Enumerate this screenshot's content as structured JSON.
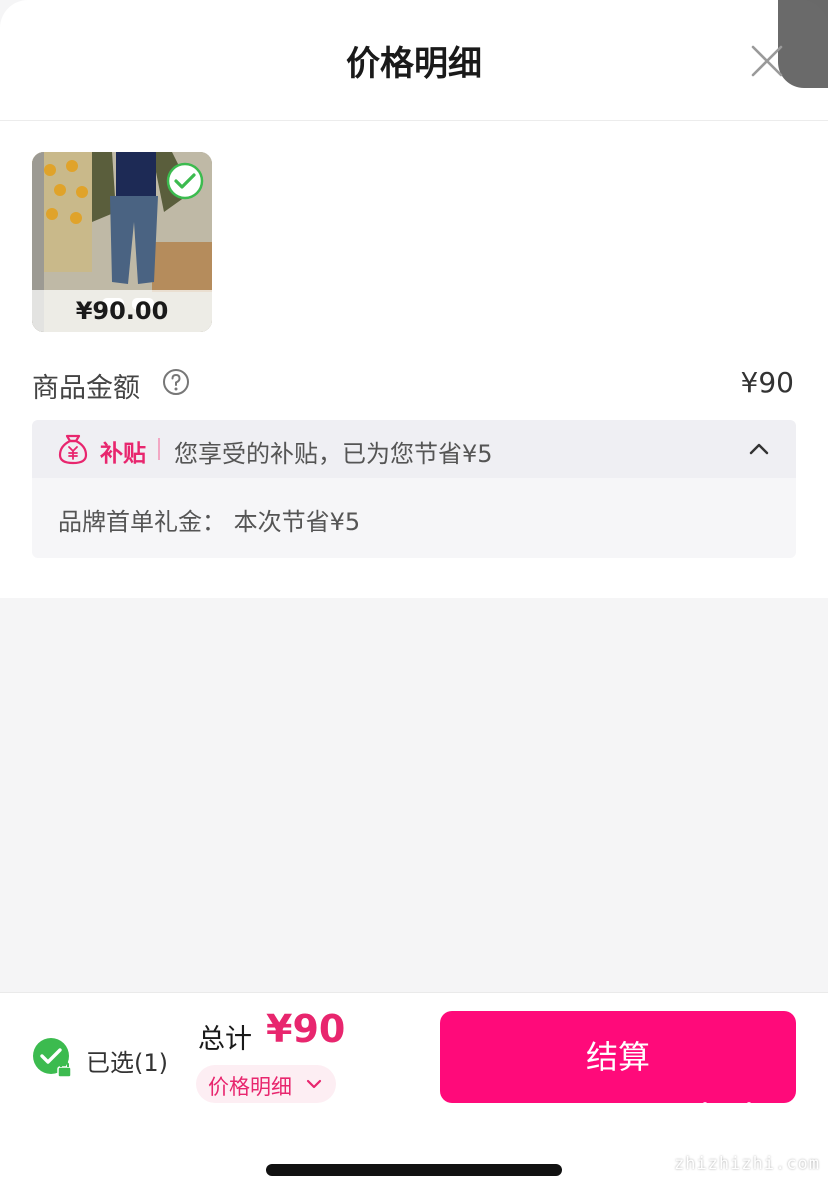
{
  "header": {
    "title": "价格明细"
  },
  "product": {
    "price": "¥90.00"
  },
  "amount": {
    "label": "商品金额",
    "value": "¥90"
  },
  "subsidy": {
    "tag": "补贴",
    "summary": "您享受的补贴，已为您节省¥5",
    "detail": "品牌首单礼金： 本次节省¥5"
  },
  "footer": {
    "selected": "已选(1)",
    "total_label": "总计",
    "total_value": "¥90",
    "detail_link": "价格明细",
    "checkout": "结算"
  },
  "watermark": {
    "text": "zhizhizhi.com"
  },
  "colors": {
    "accent": "#ff0a7a",
    "brand_pink": "#e8266e",
    "success_green": "#3cbb4f"
  }
}
